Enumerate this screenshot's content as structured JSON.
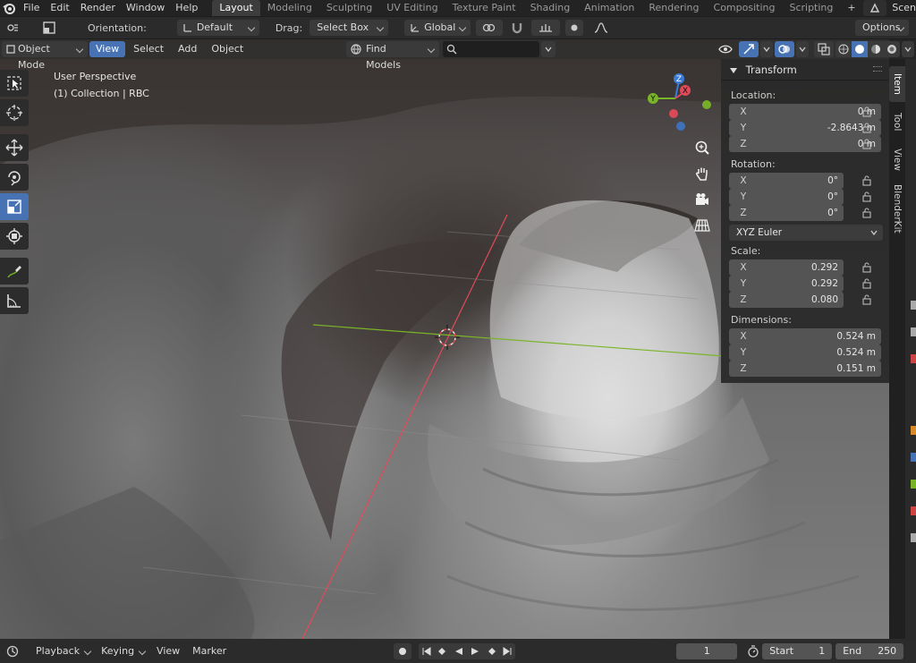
{
  "topbar": {
    "menus": [
      "File",
      "Edit",
      "Render",
      "Window",
      "Help"
    ],
    "workspaces": [
      "Layout",
      "Modeling",
      "Sculpting",
      "UV Editing",
      "Texture Paint",
      "Shading",
      "Animation",
      "Rendering",
      "Compositing",
      "Scripting"
    ],
    "active_workspace": "Layout",
    "add_tab": "+",
    "scene_label": "Scen"
  },
  "tool_header": {
    "orientation_label": "Orientation:",
    "orientation_value": "Default",
    "drag_label": "Drag:",
    "drag_value": "Select Box",
    "transform_orientation": "Global",
    "options_label": "Options"
  },
  "viewport_header": {
    "mode": "Object Mode",
    "menus": [
      "View",
      "Select",
      "Add",
      "Object"
    ],
    "active_menu": "View",
    "find_models": "Find Models",
    "search_placeholder": ""
  },
  "viewport": {
    "perspective": "User Perspective",
    "collection": "(1) Collection | RBC"
  },
  "gizmo": {
    "z": "Z",
    "y": "Y",
    "x": "X"
  },
  "transform_panel": {
    "title": "Transform",
    "location_label": "Location:",
    "location": [
      {
        "axis": "X",
        "value": "0 m"
      },
      {
        "axis": "Y",
        "value": "-2.8643 m"
      },
      {
        "axis": "Z",
        "value": "0 m"
      }
    ],
    "rotation_label": "Rotation:",
    "rotation": [
      {
        "axis": "X",
        "value": "0°"
      },
      {
        "axis": "Y",
        "value": "0°"
      },
      {
        "axis": "Z",
        "value": "0°"
      }
    ],
    "rotation_mode": "XYZ Euler",
    "scale_label": "Scale:",
    "scale": [
      {
        "axis": "X",
        "value": "0.292"
      },
      {
        "axis": "Y",
        "value": "0.292"
      },
      {
        "axis": "Z",
        "value": "0.080"
      }
    ],
    "dimensions_label": "Dimensions:",
    "dimensions": [
      {
        "axis": "X",
        "value": "0.524 m"
      },
      {
        "axis": "Y",
        "value": "0.524 m"
      },
      {
        "axis": "Z",
        "value": "0.151 m"
      }
    ]
  },
  "sidebar_tabs": [
    "Item",
    "Tool",
    "View",
    "BlenderKit"
  ],
  "active_sidebar_tab": "Item",
  "timeline": {
    "playback": "Playback",
    "keying": "Keying",
    "view": "View",
    "marker": "Marker",
    "current_frame": "1",
    "start_label": "Start",
    "start_value": "1",
    "end_label": "End",
    "end_value": "250"
  },
  "colors": {
    "accent": "#4772b3",
    "x_axis": "#e24a5a",
    "y_axis": "#7ab428",
    "z_axis": "#3b7cd6"
  }
}
